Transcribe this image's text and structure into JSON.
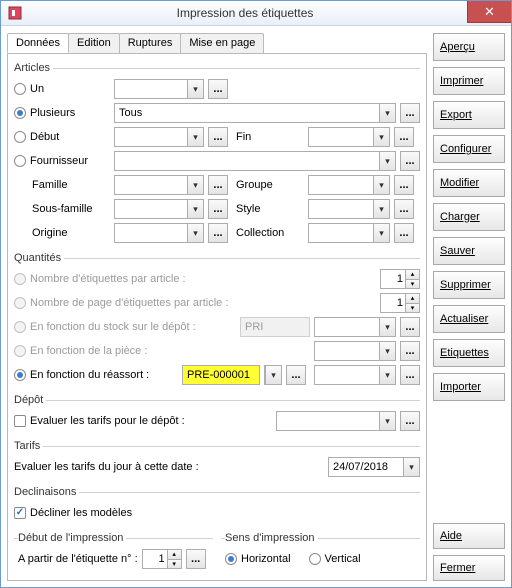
{
  "window": {
    "title": "Impression des étiquettes"
  },
  "tabs": [
    "Données",
    "Edition",
    "Ruptures",
    "Mise en page"
  ],
  "active_tab": 0,
  "articles": {
    "legend": "Articles",
    "un": "Un",
    "plusieurs": "Plusieurs",
    "plusieurs_val": "Tous",
    "debut": "Début",
    "fin": "Fin",
    "fournisseur": "Fournisseur",
    "famille": "Famille",
    "groupe": "Groupe",
    "sousfamille": "Sous-famille",
    "style": "Style",
    "origine": "Origine",
    "collection": "Collection"
  },
  "quantites": {
    "legend": "Quantités",
    "nb_par_article": "Nombre d'étiquettes par article :",
    "nb_par_article_v": "1",
    "nb_page": "Nombre de page d'étiquettes par article :",
    "nb_page_v": "1",
    "stock": "En fonction du stock sur le dépôt :",
    "stock_v": "PRI",
    "piece": "En fonction de la pièce :",
    "reassort": "En fonction du réassort :",
    "reassort_v": "PRE-000001"
  },
  "depot": {
    "legend": "Dépôt",
    "eval": "Evaluer les tarifs pour le dépôt :"
  },
  "tarifs": {
    "legend": "Tarifs",
    "eval_date": "Evaluer les tarifs du jour à cette date :",
    "date": "24/07/2018"
  },
  "decl": {
    "legend": "Declinaisons",
    "decliner": "Décliner les modèles"
  },
  "debut_imp": {
    "legend": "Début de l'impression",
    "apartir": "A partir de l'étiquette n° :",
    "val": "1"
  },
  "sens": {
    "legend": "Sens d'impression",
    "h": "Horizontal",
    "v": "Vertical"
  },
  "buttons": {
    "apercu": "Aperçu",
    "imprimer": "Imprimer",
    "export": "Export",
    "configurer": "Configurer",
    "modifier": "Modifier",
    "charger": "Charger",
    "sauver": "Sauver",
    "supprimer": "Supprimer",
    "actualiser": "Actualiser",
    "etiquettes": "Etiquettes",
    "importer": "Importer",
    "aide": "Aide",
    "fermer": "Fermer"
  }
}
